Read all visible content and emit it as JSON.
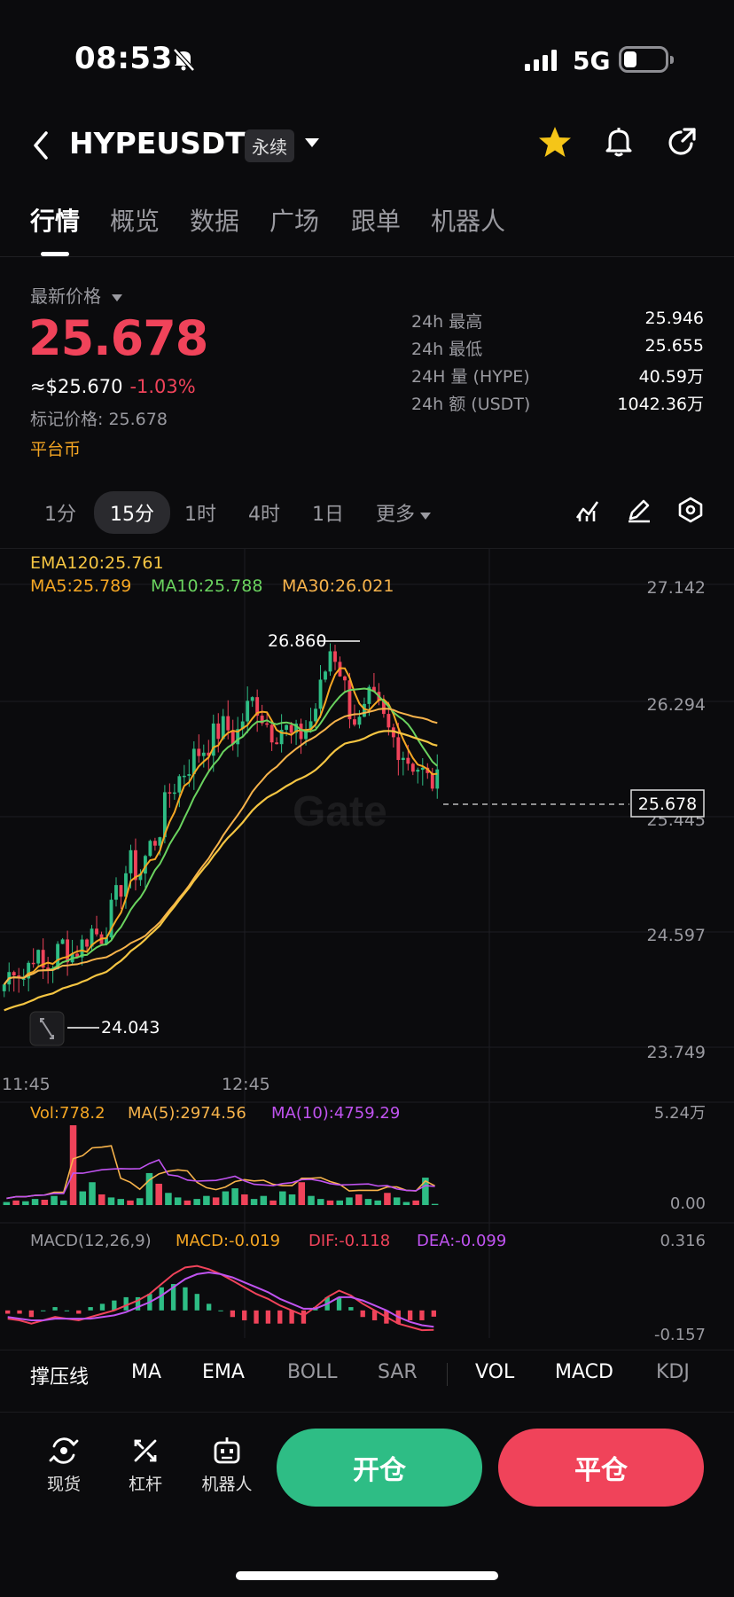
{
  "status": {
    "time": "08:53",
    "network": "5G"
  },
  "header": {
    "pair": "HYPEUSDT",
    "contract_type": "永续"
  },
  "tabs": [
    {
      "label": "行情",
      "active": true
    },
    {
      "label": "概览",
      "active": false
    },
    {
      "label": "数据",
      "active": false
    },
    {
      "label": "广场",
      "active": false
    },
    {
      "label": "跟单",
      "active": false
    },
    {
      "label": "机器人",
      "active": false
    }
  ],
  "price": {
    "latest_label": "最新价格",
    "last": "25.678",
    "usd": "≈$25.670",
    "change": "-1.03%",
    "mark": "标记价格: 25.678",
    "tag": "平台币"
  },
  "stats": [
    {
      "label": "24h  最高",
      "value": "25.946"
    },
    {
      "label": "24h  最低",
      "value": "25.655"
    },
    {
      "label": "24H  量 (HYPE)",
      "value": "40.59万"
    },
    {
      "label": "24h  额 (USDT)",
      "value": "1042.36万"
    }
  ],
  "timeframes": [
    {
      "label": "1分",
      "active": false
    },
    {
      "label": "15分",
      "active": true
    },
    {
      "label": "1时",
      "active": false
    },
    {
      "label": "4时",
      "active": false
    },
    {
      "label": "1日",
      "active": false
    },
    {
      "label": "更多",
      "active": false
    }
  ],
  "chart_data": {
    "type": "candlestick",
    "watermark": "Gate",
    "legend": {
      "ema": "EMA120:25.761",
      "ma5": "MA5:25.789",
      "ma10": "MA10:25.788",
      "ma30": "MA30:26.021"
    },
    "y_ticks": [
      "27.142",
      "26.294",
      "25.445",
      "24.597",
      "23.749"
    ],
    "y_range": [
      23.749,
      27.142
    ],
    "x_ticks": [
      "11:45",
      "12:45"
    ],
    "high_marker": "26.860",
    "low_marker": "24.043",
    "current_price": "25.678",
    "close_path": [
      24.2,
      24.35,
      24.25,
      24.45,
      24.3,
      24.35,
      24.5,
      24.42,
      24.48,
      24.6,
      24.55,
      24.7,
      24.9,
      25.1,
      25.0,
      25.2,
      25.3,
      25.6,
      25.7,
      25.8,
      25.9,
      25.95,
      26.05,
      26.1,
      26.0,
      26.2,
      26.3,
      26.15,
      26.05,
      26.1,
      26.0,
      26.05,
      26.15,
      26.4,
      26.7,
      26.5,
      26.2,
      26.1,
      26.3,
      26.2,
      26.05,
      25.95,
      25.85,
      25.8,
      25.7,
      25.68
    ],
    "colors": {
      "up": "#2ebd85",
      "down": "#f0435a",
      "ma5": "#f5a623",
      "ma10": "#6ad35f",
      "ma30": "#f7b34b",
      "ema120": "#f5c542"
    },
    "volume": {
      "legend": {
        "vol": "Vol:778.2",
        "ma5": "MA(5):2974.56",
        "ma10": "MA(10):4759.29"
      },
      "y_ticks": [
        "5.24万",
        "0.00"
      ],
      "y_range": [
        0,
        52400
      ],
      "values": [
        2000,
        3000,
        2500,
        4000,
        3500,
        6000,
        3000,
        52400,
        9000,
        15000,
        7000,
        5000,
        4000,
        3000,
        4500,
        21000,
        14000,
        8000,
        5000,
        3000,
        4000,
        6000,
        5000,
        9000,
        11000,
        7000,
        4000,
        6000,
        3000,
        9000,
        7000,
        15000,
        6000,
        4000,
        3000,
        3000,
        5000,
        7000,
        4000,
        3000,
        8000,
        5000,
        2000,
        3000,
        18000,
        778
      ]
    },
    "macd": {
      "legend": {
        "title": "MACD(12,26,9)",
        "macd": "MACD:-0.019",
        "dif": "DIF:-0.118",
        "dea": "DEA:-0.099"
      },
      "y_ticks": [
        "0.316",
        "-0.157"
      ],
      "y_range": [
        -0.157,
        0.316
      ],
      "dif": [
        -0.05,
        -0.06,
        -0.08,
        -0.06,
        -0.04,
        -0.05,
        -0.06,
        -0.04,
        -0.02,
        0.0,
        0.03,
        0.06,
        0.1,
        0.16,
        0.22,
        0.26,
        0.27,
        0.25,
        0.22,
        0.18,
        0.14,
        0.1,
        0.07,
        0.03,
        0.0,
        -0.03,
        0.02,
        0.08,
        0.12,
        0.09,
        0.04,
        0.0,
        -0.04,
        -0.08,
        -0.1,
        -0.12,
        -0.118
      ],
      "dea": [
        -0.04,
        -0.05,
        -0.06,
        -0.06,
        -0.05,
        -0.05,
        -0.05,
        -0.05,
        -0.04,
        -0.03,
        -0.01,
        0.02,
        0.05,
        0.09,
        0.14,
        0.19,
        0.22,
        0.23,
        0.22,
        0.2,
        0.17,
        0.14,
        0.11,
        0.07,
        0.04,
        0.01,
        0.01,
        0.04,
        0.08,
        0.08,
        0.06,
        0.03,
        0.0,
        -0.04,
        -0.07,
        -0.09,
        -0.099
      ]
    }
  },
  "indicator_tabs": [
    {
      "label": "撑压线",
      "on": true
    },
    {
      "label": "MA",
      "on": true
    },
    {
      "label": "EMA",
      "on": true
    },
    {
      "label": "BOLL",
      "on": false
    },
    {
      "label": "SAR",
      "on": false
    },
    {
      "label": "VOL",
      "on": true
    },
    {
      "label": "MACD",
      "on": true
    },
    {
      "label": "KDJ",
      "on": false
    }
  ],
  "bottom_nav": [
    {
      "label": "现货",
      "icon": "spot-icon"
    },
    {
      "label": "杠杆",
      "icon": "leverage-icon"
    },
    {
      "label": "机器人",
      "icon": "robot-icon"
    }
  ],
  "actions": {
    "open": "开仓",
    "close": "平仓"
  }
}
